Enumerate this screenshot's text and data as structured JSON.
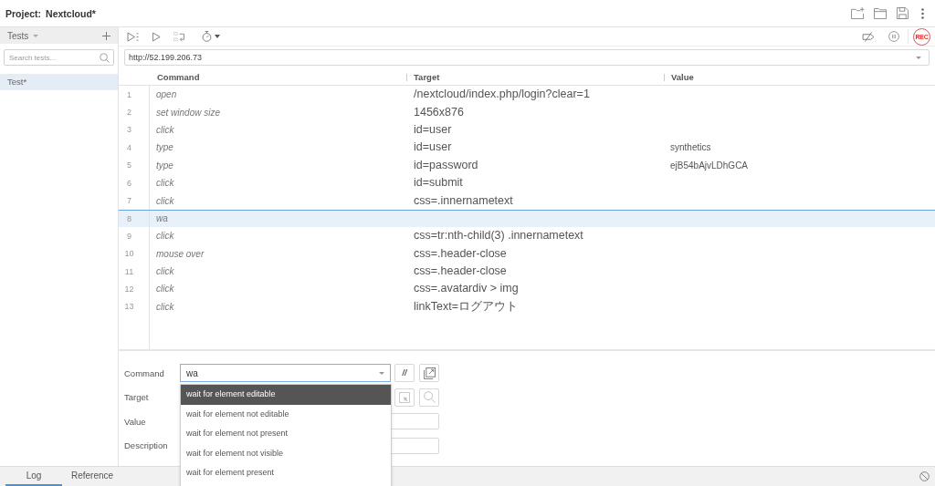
{
  "project": {
    "label": "Project:",
    "name": "Nextcloud*"
  },
  "sidebar": {
    "title": "Tests",
    "search": {
      "placeholder": "Search tests..."
    },
    "items": [
      {
        "label": "Test*",
        "selected": true
      }
    ]
  },
  "record_button": {
    "label": "REC"
  },
  "url": {
    "value": "http://52.199.206.73"
  },
  "table": {
    "columns": [
      "Command",
      "Target",
      "Value"
    ],
    "rows": [
      {
        "number": "1",
        "command": "open",
        "target": "/nextcloud/index.php/login?clear=1",
        "selected": false
      },
      {
        "number": "2",
        "command": "set window size",
        "target": "1456x876",
        "selected": false
      },
      {
        "number": "3",
        "command": "click",
        "target": "id=user",
        "selected": false
      },
      {
        "number": "4",
        "command": "type",
        "target": "id=user",
        "value": "synthetics",
        "selected": false
      },
      {
        "number": "5",
        "command": "type",
        "target": "id=password",
        "value": "ejB54bAjvLDhGCA",
        "selected": false
      },
      {
        "number": "6",
        "command": "click",
        "target": "id=submit",
        "selected": false
      },
      {
        "number": "7",
        "command": "click",
        "target": "css=.innernametext",
        "selected": false
      },
      {
        "number": "8",
        "command": "wa",
        "selected": true
      },
      {
        "number": "9",
        "command": "click",
        "target": "css=tr:nth-child(3) .innernametext",
        "selected": false
      },
      {
        "number": "10",
        "command": "mouse over",
        "target": "css=.header-close",
        "selected": false
      },
      {
        "number": "11",
        "command": "click",
        "target": "css=.header-close",
        "selected": false
      },
      {
        "number": "12",
        "command": "click",
        "target": "css=.avatardiv > img",
        "selected": false
      },
      {
        "number": "13",
        "command": "click",
        "target": "linkText=ログアウト",
        "selected": false
      }
    ]
  },
  "editor": {
    "fields": [
      {
        "kind": "command",
        "label": "Command",
        "value": "wa",
        "comment_button": "//"
      },
      {
        "kind": "target",
        "label": "Target"
      },
      {
        "kind": "text",
        "label": "Value"
      },
      {
        "kind": "text",
        "label": "Description"
      }
    ],
    "suggestions": [
      {
        "label": "wait for element editable",
        "selected": true
      },
      {
        "label": "wait for element not editable",
        "selected": false
      },
      {
        "label": "wait for element not present",
        "selected": false
      },
      {
        "label": "wait for element not visible",
        "selected": false
      },
      {
        "label": "wait for element present",
        "selected": false
      }
    ]
  },
  "bottom_tabs": [
    {
      "label": "Log",
      "selected": true
    },
    {
      "label": "Reference",
      "selected": false
    }
  ]
}
